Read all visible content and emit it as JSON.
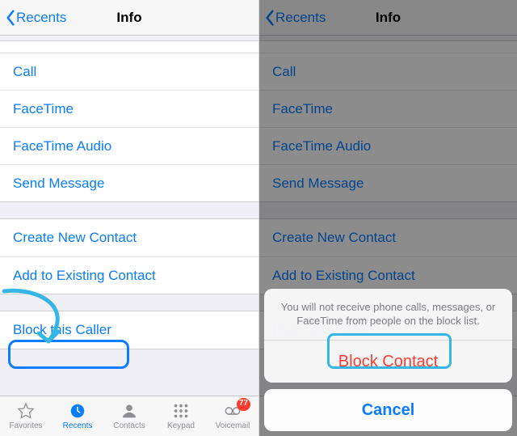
{
  "nav": {
    "back_label": "Recents",
    "title": "Info"
  },
  "actions_group": [
    "Call",
    "FaceTime",
    "FaceTime Audio",
    "Send Message"
  ],
  "contact_group": [
    "Create New Contact",
    "Add to Existing Contact"
  ],
  "block_group": [
    "Block this Caller"
  ],
  "tabs": {
    "favorites": "Favorites",
    "recents": "Recents",
    "contacts": "Contacts",
    "keypad": "Keypad",
    "voicemail": "Voicemail",
    "voicemail_badge": "77"
  },
  "sheet": {
    "message": "You will not receive phone calls, messages, or FaceTime from people on the block list.",
    "block": "Block Contact",
    "cancel": "Cancel"
  }
}
